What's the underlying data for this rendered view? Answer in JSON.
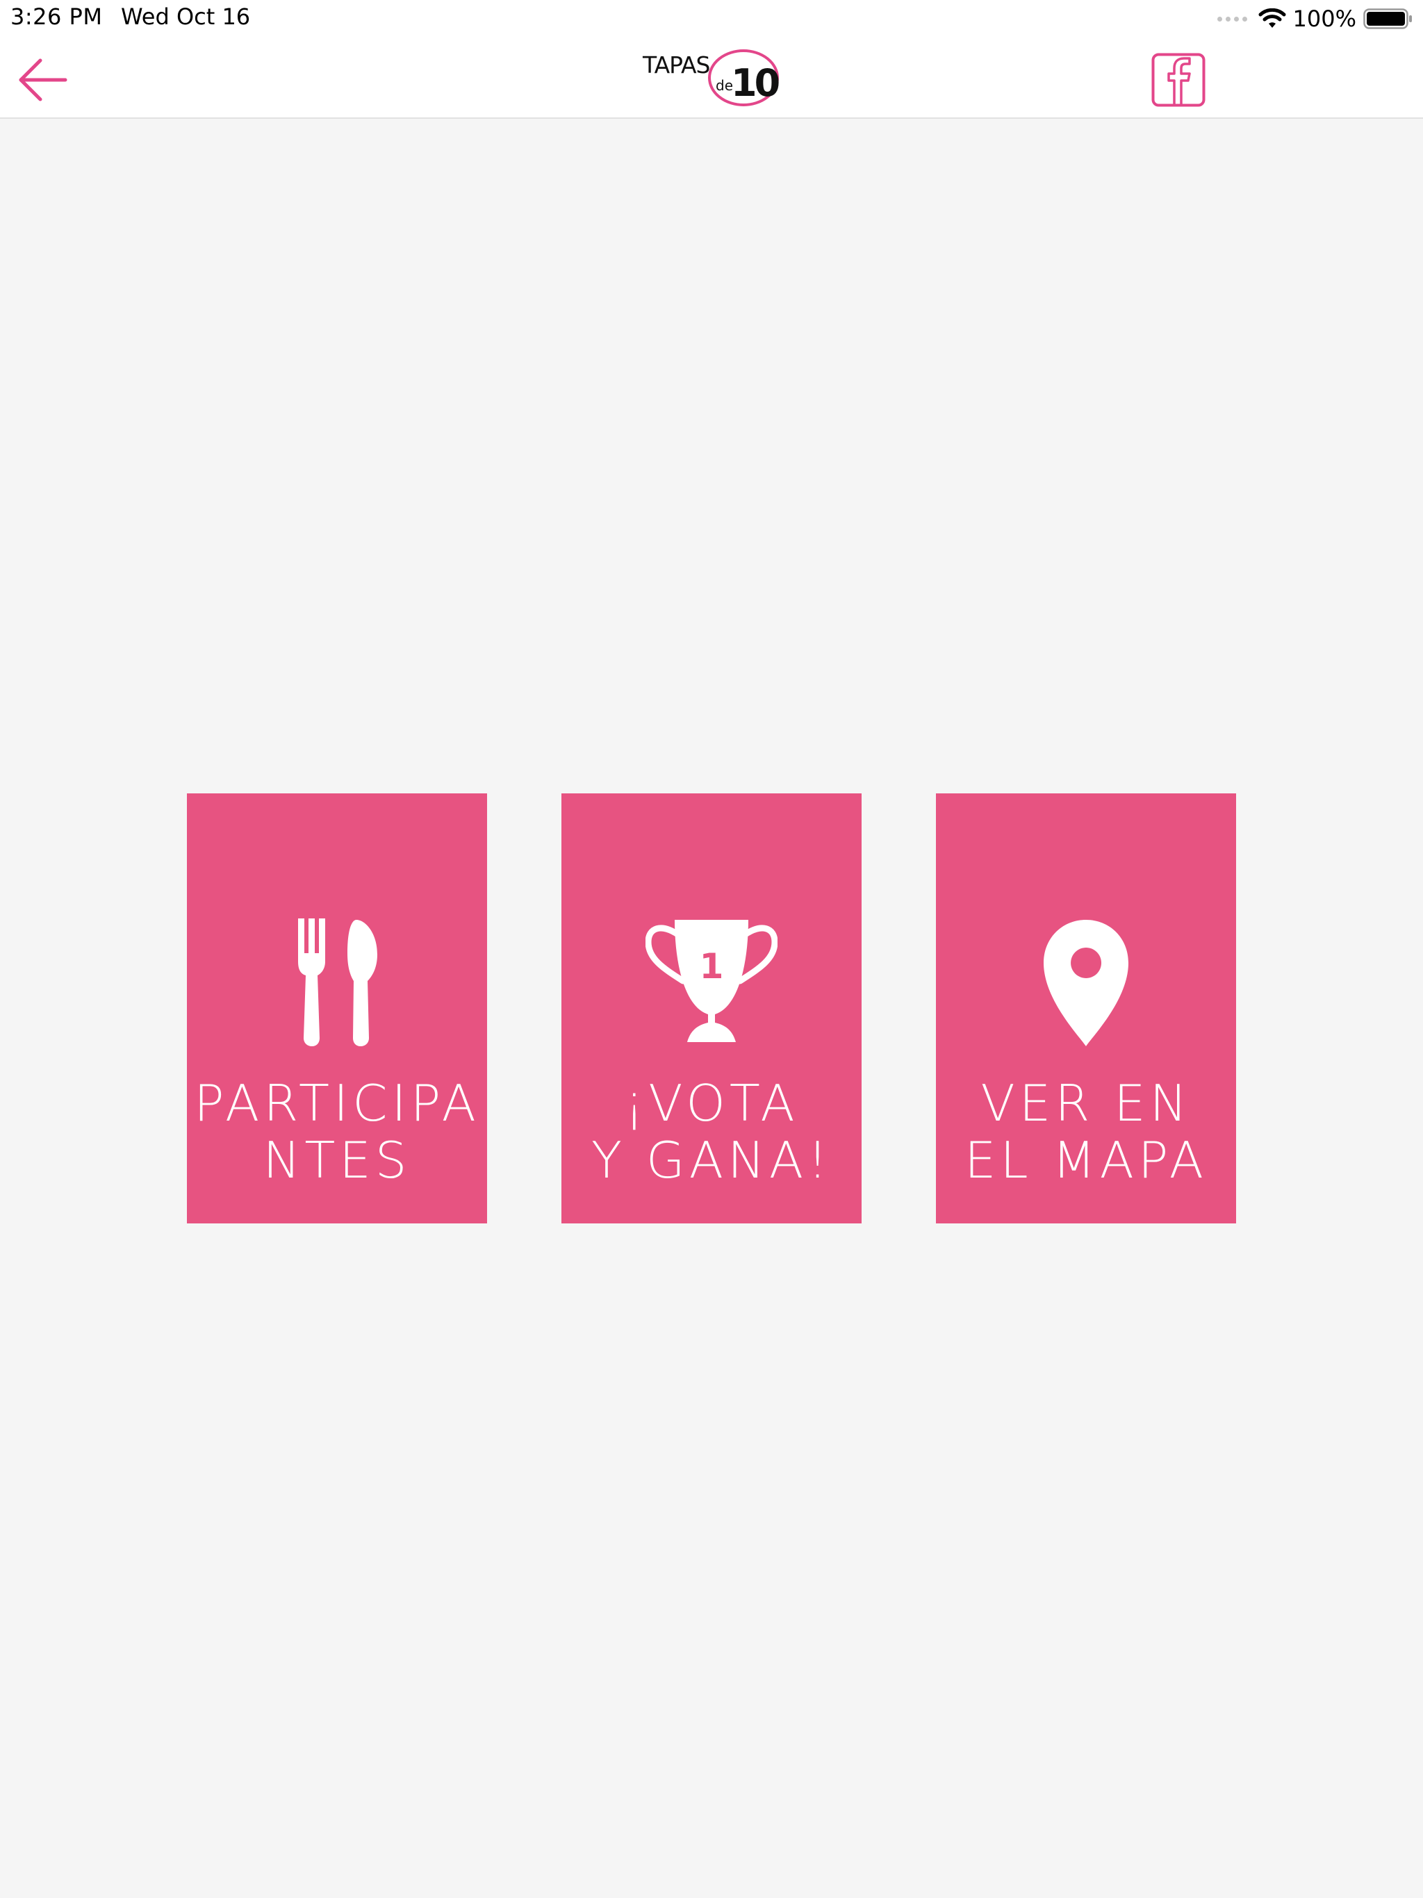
{
  "status_bar": {
    "time": "3:26 PM",
    "date": "Wed Oct 16",
    "battery": "100%"
  },
  "header": {
    "logo_text_top": "TAPAS",
    "logo_text_small": "de",
    "logo_text_number": "10"
  },
  "tiles": [
    {
      "line1": "PARTICIPA",
      "line2": "NTES",
      "icon": "cutlery-icon"
    },
    {
      "line1": "¡VOTA",
      "line2": "Y GANA!",
      "icon": "trophy-icon",
      "trophy_number": "1"
    },
    {
      "line1": "VER EN",
      "line2": "EL MAPA",
      "icon": "map-pin-icon"
    }
  ],
  "colors": {
    "accent": "#e75381",
    "background": "#f5f5f5",
    "header": "#ffffff"
  }
}
